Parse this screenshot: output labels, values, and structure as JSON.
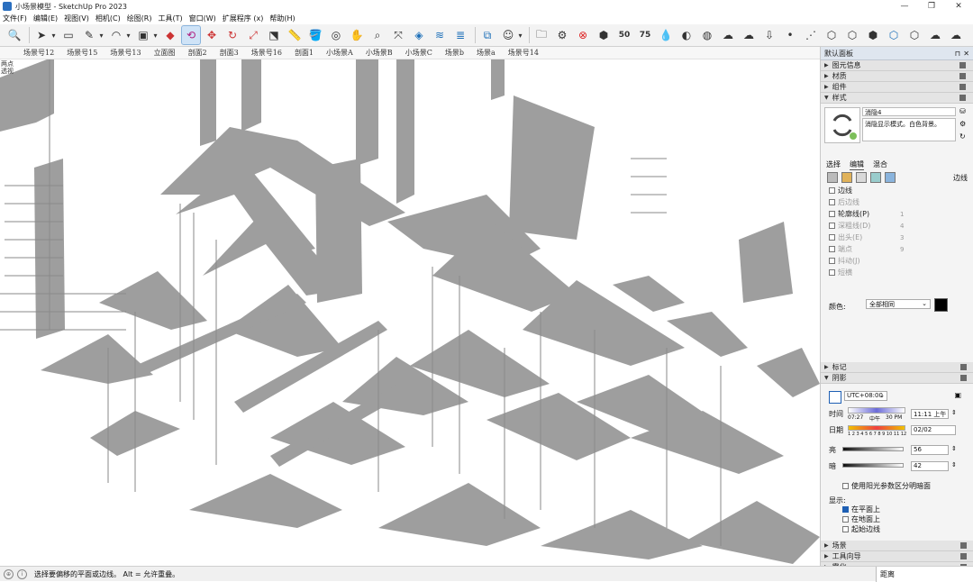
{
  "window": {
    "title": "小场景模型 - SketchUp Pro 2023",
    "controls": [
      "—",
      "❐",
      "✕"
    ]
  },
  "menu": [
    "文件(F)",
    "编辑(E)",
    "视图(V)",
    "相机(C)",
    "绘图(R)",
    "工具(T)",
    "窗口(W)",
    "扩展程序 (x)",
    "帮助(H)"
  ],
  "toolbar": {
    "icons": [
      "zoom-icon",
      "select-icon",
      "dropdown-icon",
      "eraser-icon",
      "pencil-icon",
      "dropdown-icon",
      "arc-icon",
      "dropdown-icon",
      "rectangle-icon",
      "dropdown-icon",
      "pushpull-icon",
      "offset-icon",
      "move-icon",
      "rotate-icon",
      "scale-icon",
      "followme-icon",
      "tape-icon",
      "paint-icon",
      "orbit-icon",
      "pan-icon",
      "zoom-window-icon",
      "zoom-extents-icon",
      "layer-icon",
      "tag-icon",
      "section-icon",
      "layers-icon",
      "user-icon",
      "dropdown-icon",
      "folder-icon",
      "gear-icon",
      "delete-icon",
      "3dwarehouse-icon",
      "render50-icon",
      "render75-icon",
      "drop-icon",
      "contrast-icon",
      "texture-icon",
      "cloud-x-icon",
      "cloud-upload-icon",
      "export-icon",
      "dot-icon",
      "dotted-line-icon",
      "view-iso-icon",
      "view-top-icon",
      "view-front-icon",
      "view-right-icon",
      "view-back-icon",
      "cloud-sync-icon",
      "cloud-refresh-icon"
    ],
    "active_index": 11
  },
  "scenes": [
    "场景号12",
    "场景号15",
    "场景号13",
    "立面图",
    "剖面2",
    "剖面3",
    "场景号16",
    "剖面1",
    "小场景A",
    "小场景B",
    "小场景C",
    "场景b",
    "场景a",
    "场景号14"
  ],
  "viewport": {
    "label_line1": "两点",
    "label_line2": "透视"
  },
  "status": {
    "message": "选择要偏移的平面或边线。 Alt = 允许重叠。",
    "measurement_label": "距离"
  },
  "tray": {
    "title": "默认面板",
    "panels_top": [
      "图元信息",
      "材质",
      "组件",
      "样式"
    ],
    "style": {
      "name": "消隐4",
      "description": "消隐显示模式。白色背景。",
      "tabs": [
        "选择",
        "编辑",
        "混合"
      ],
      "active_tab": 1,
      "edge_section_label": "边线",
      "edges": [
        {
          "label": "边线",
          "checked": false,
          "enabled": true,
          "value": ""
        },
        {
          "label": "后边线",
          "checked": false,
          "enabled": false,
          "value": ""
        },
        {
          "label": "轮廓线(P)",
          "checked": false,
          "enabled": true,
          "value": "1"
        },
        {
          "label": "深粗线(D)",
          "checked": false,
          "enabled": false,
          "value": "4"
        },
        {
          "label": "出头(E)",
          "checked": false,
          "enabled": false,
          "value": "3"
        },
        {
          "label": "端点",
          "checked": false,
          "enabled": false,
          "value": "9"
        },
        {
          "label": "抖动(J)",
          "checked": false,
          "enabled": false,
          "value": ""
        },
        {
          "label": "短横",
          "checked": false,
          "enabled": false,
          "value": ""
        }
      ],
      "color_label": "颜色:",
      "color_value": "全部相同",
      "color_swatch": "#000000"
    },
    "panels_mid": [
      "标记",
      "阴影"
    ],
    "shadow": {
      "timezone": "UTC+08:00",
      "time_label": "时间",
      "time_scale_left": "07:27",
      "time_scale_mid": "中午",
      "time_scale_right": "30 PM",
      "time_value": "11:11 上午",
      "date_label": "日期",
      "date_scale": "1 2 3 4 5 6 7 8 9 10 11 12",
      "date_value": "02/02",
      "light_label": "亮",
      "light_value": "56",
      "dark_label": "暗",
      "dark_value": "42",
      "use_sun": "使用阳光参数区分明暗面",
      "display_label": "显示:",
      "display_opts": [
        {
          "label": "在平面上",
          "checked": true
        },
        {
          "label": "在地面上",
          "checked": false
        },
        {
          "label": "起始边线",
          "checked": false
        }
      ]
    },
    "panels_bottom": [
      "场景",
      "工具向导",
      "雾化"
    ]
  }
}
